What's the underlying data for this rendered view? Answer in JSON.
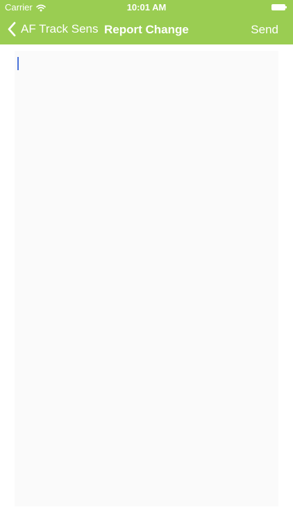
{
  "status_bar": {
    "carrier": "Carrier",
    "time": "10:01 AM",
    "wifi_icon": "wifi-icon",
    "battery_icon": "battery-icon"
  },
  "nav": {
    "back_label": "AF Track Sens",
    "back_icon": "chevron-left-icon",
    "title": "Report Change",
    "send_label": "Send"
  },
  "editor": {
    "value": ""
  },
  "colors": {
    "accent": "#9acd52",
    "editor_background": "#fafafa",
    "cursor": "#4a72d9"
  }
}
